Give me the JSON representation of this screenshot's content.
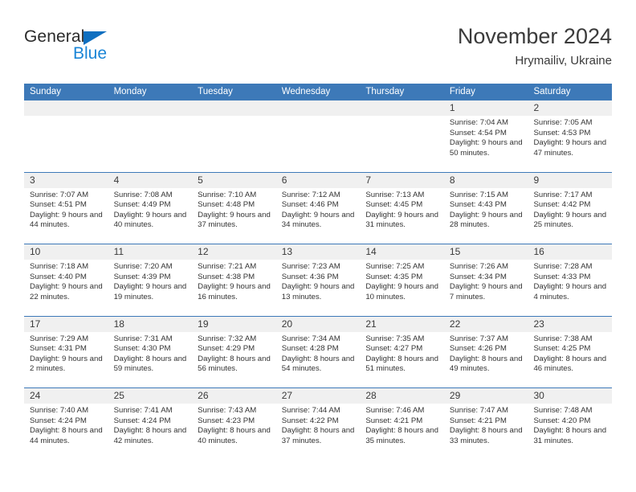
{
  "brand": {
    "name_part1": "General",
    "name_part2": "Blue",
    "logo_icon": "triangle-logo-icon",
    "accent_color": "#1a85d6"
  },
  "header": {
    "title": "November 2024",
    "location": "Hrymailiv, Ukraine"
  },
  "calendar": {
    "header_color": "#3d79b8",
    "day_band_color": "#f0f0f0",
    "day_names": [
      "Sunday",
      "Monday",
      "Tuesday",
      "Wednesday",
      "Thursday",
      "Friday",
      "Saturday"
    ],
    "weeks": [
      [
        {
          "blank": true
        },
        {
          "blank": true
        },
        {
          "blank": true
        },
        {
          "blank": true
        },
        {
          "blank": true
        },
        {
          "date": "1",
          "sunrise": "Sunrise: 7:04 AM",
          "sunset": "Sunset: 4:54 PM",
          "daylight": "Daylight: 9 hours and 50 minutes."
        },
        {
          "date": "2",
          "sunrise": "Sunrise: 7:05 AM",
          "sunset": "Sunset: 4:53 PM",
          "daylight": "Daylight: 9 hours and 47 minutes."
        }
      ],
      [
        {
          "date": "3",
          "sunrise": "Sunrise: 7:07 AM",
          "sunset": "Sunset: 4:51 PM",
          "daylight": "Daylight: 9 hours and 44 minutes."
        },
        {
          "date": "4",
          "sunrise": "Sunrise: 7:08 AM",
          "sunset": "Sunset: 4:49 PM",
          "daylight": "Daylight: 9 hours and 40 minutes."
        },
        {
          "date": "5",
          "sunrise": "Sunrise: 7:10 AM",
          "sunset": "Sunset: 4:48 PM",
          "daylight": "Daylight: 9 hours and 37 minutes."
        },
        {
          "date": "6",
          "sunrise": "Sunrise: 7:12 AM",
          "sunset": "Sunset: 4:46 PM",
          "daylight": "Daylight: 9 hours and 34 minutes."
        },
        {
          "date": "7",
          "sunrise": "Sunrise: 7:13 AM",
          "sunset": "Sunset: 4:45 PM",
          "daylight": "Daylight: 9 hours and 31 minutes."
        },
        {
          "date": "8",
          "sunrise": "Sunrise: 7:15 AM",
          "sunset": "Sunset: 4:43 PM",
          "daylight": "Daylight: 9 hours and 28 minutes."
        },
        {
          "date": "9",
          "sunrise": "Sunrise: 7:17 AM",
          "sunset": "Sunset: 4:42 PM",
          "daylight": "Daylight: 9 hours and 25 minutes."
        }
      ],
      [
        {
          "date": "10",
          "sunrise": "Sunrise: 7:18 AM",
          "sunset": "Sunset: 4:40 PM",
          "daylight": "Daylight: 9 hours and 22 minutes."
        },
        {
          "date": "11",
          "sunrise": "Sunrise: 7:20 AM",
          "sunset": "Sunset: 4:39 PM",
          "daylight": "Daylight: 9 hours and 19 minutes."
        },
        {
          "date": "12",
          "sunrise": "Sunrise: 7:21 AM",
          "sunset": "Sunset: 4:38 PM",
          "daylight": "Daylight: 9 hours and 16 minutes."
        },
        {
          "date": "13",
          "sunrise": "Sunrise: 7:23 AM",
          "sunset": "Sunset: 4:36 PM",
          "daylight": "Daylight: 9 hours and 13 minutes."
        },
        {
          "date": "14",
          "sunrise": "Sunrise: 7:25 AM",
          "sunset": "Sunset: 4:35 PM",
          "daylight": "Daylight: 9 hours and 10 minutes."
        },
        {
          "date": "15",
          "sunrise": "Sunrise: 7:26 AM",
          "sunset": "Sunset: 4:34 PM",
          "daylight": "Daylight: 9 hours and 7 minutes."
        },
        {
          "date": "16",
          "sunrise": "Sunrise: 7:28 AM",
          "sunset": "Sunset: 4:33 PM",
          "daylight": "Daylight: 9 hours and 4 minutes."
        }
      ],
      [
        {
          "date": "17",
          "sunrise": "Sunrise: 7:29 AM",
          "sunset": "Sunset: 4:31 PM",
          "daylight": "Daylight: 9 hours and 2 minutes."
        },
        {
          "date": "18",
          "sunrise": "Sunrise: 7:31 AM",
          "sunset": "Sunset: 4:30 PM",
          "daylight": "Daylight: 8 hours and 59 minutes."
        },
        {
          "date": "19",
          "sunrise": "Sunrise: 7:32 AM",
          "sunset": "Sunset: 4:29 PM",
          "daylight": "Daylight: 8 hours and 56 minutes."
        },
        {
          "date": "20",
          "sunrise": "Sunrise: 7:34 AM",
          "sunset": "Sunset: 4:28 PM",
          "daylight": "Daylight: 8 hours and 54 minutes."
        },
        {
          "date": "21",
          "sunrise": "Sunrise: 7:35 AM",
          "sunset": "Sunset: 4:27 PM",
          "daylight": "Daylight: 8 hours and 51 minutes."
        },
        {
          "date": "22",
          "sunrise": "Sunrise: 7:37 AM",
          "sunset": "Sunset: 4:26 PM",
          "daylight": "Daylight: 8 hours and 49 minutes."
        },
        {
          "date": "23",
          "sunrise": "Sunrise: 7:38 AM",
          "sunset": "Sunset: 4:25 PM",
          "daylight": "Daylight: 8 hours and 46 minutes."
        }
      ],
      [
        {
          "date": "24",
          "sunrise": "Sunrise: 7:40 AM",
          "sunset": "Sunset: 4:24 PM",
          "daylight": "Daylight: 8 hours and 44 minutes."
        },
        {
          "date": "25",
          "sunrise": "Sunrise: 7:41 AM",
          "sunset": "Sunset: 4:24 PM",
          "daylight": "Daylight: 8 hours and 42 minutes."
        },
        {
          "date": "26",
          "sunrise": "Sunrise: 7:43 AM",
          "sunset": "Sunset: 4:23 PM",
          "daylight": "Daylight: 8 hours and 40 minutes."
        },
        {
          "date": "27",
          "sunrise": "Sunrise: 7:44 AM",
          "sunset": "Sunset: 4:22 PM",
          "daylight": "Daylight: 8 hours and 37 minutes."
        },
        {
          "date": "28",
          "sunrise": "Sunrise: 7:46 AM",
          "sunset": "Sunset: 4:21 PM",
          "daylight": "Daylight: 8 hours and 35 minutes."
        },
        {
          "date": "29",
          "sunrise": "Sunrise: 7:47 AM",
          "sunset": "Sunset: 4:21 PM",
          "daylight": "Daylight: 8 hours and 33 minutes."
        },
        {
          "date": "30",
          "sunrise": "Sunrise: 7:48 AM",
          "sunset": "Sunset: 4:20 PM",
          "daylight": "Daylight: 8 hours and 31 minutes."
        }
      ]
    ]
  }
}
